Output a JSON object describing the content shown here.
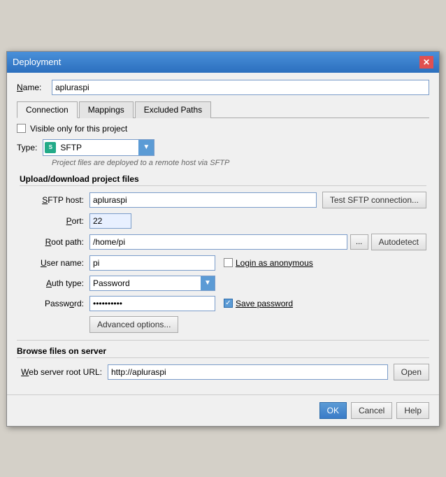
{
  "dialog": {
    "title": "Deployment",
    "close_label": "✕"
  },
  "name": {
    "label": "Name:",
    "label_underline": "N",
    "value": "apluraspi"
  },
  "tabs": [
    {
      "label": "Connection",
      "active": true
    },
    {
      "label": "Mappings",
      "active": false
    },
    {
      "label": "Excluded Paths",
      "active": false
    }
  ],
  "visible_checkbox": {
    "label": "Visible only for this project",
    "checked": false
  },
  "type": {
    "label": "Type:",
    "label_underline": "T",
    "icon_text": "S",
    "value": "SFTP",
    "arrow": "▼",
    "hint": "Project files are deployed to a remote host via SFTP"
  },
  "upload_section": {
    "title": "Upload/download project files",
    "sftp_host": {
      "label": "SFTP host:",
      "label_underline": "S",
      "value": "apluraspi",
      "test_btn": "Test SFTP connection..."
    },
    "port": {
      "label": "Port:",
      "label_underline": "P",
      "value": "22"
    },
    "root_path": {
      "label": "Root path:",
      "label_underline": "R",
      "value": "/home/pi",
      "browse_btn": "...",
      "autodetect_btn": "Autodetect"
    },
    "user_name": {
      "label": "User name:",
      "label_underline": "U",
      "value": "pi",
      "login_anonymous_label": "Login as anonymous",
      "login_anonymous_underline": "a"
    },
    "auth_type": {
      "label": "Auth type:",
      "label_underline": "A",
      "value": "Password",
      "arrow": "▼"
    },
    "password": {
      "label": "Password:",
      "label_underline": "o",
      "value": "••••••••••",
      "save_label": "Save password",
      "save_underline": "S",
      "save_checked": true
    },
    "advanced_btn": "Advanced options..."
  },
  "browse_section": {
    "title": "Browse files on server",
    "web_url": {
      "label": "Web server root URL:",
      "label_underline": "W",
      "value": "http://apluraspi",
      "open_btn": "Open"
    }
  },
  "footer": {
    "ok_btn": "OK",
    "cancel_btn": "Cancel",
    "help_btn": "Help"
  }
}
